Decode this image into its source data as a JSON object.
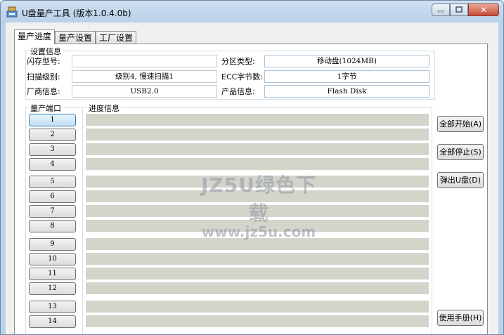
{
  "window": {
    "title": "U盘量产工具 (版本1.0.4.0b)",
    "close_glyph": "✕"
  },
  "tabs": [
    {
      "label": "量产进度"
    },
    {
      "label": "量产设置"
    },
    {
      "label": "工厂设置"
    }
  ],
  "settings": {
    "title": "设置信息",
    "flash_model_label": "闪存型号:",
    "flash_model_value": "",
    "scan_level_label": "扫描级别:",
    "scan_level_value": "级别4, 慢速扫描1",
    "vendor_label": "厂商信息:",
    "vendor_value": "USB2.0",
    "partition_label": "分区类型:",
    "partition_value": "移动盘(1024MB)",
    "ecc_label": "ECC字节数:",
    "ecc_value": "1字节",
    "product_label": "产品信息:",
    "product_value": "Flash Disk"
  },
  "ports": {
    "title": "量产端口",
    "labels": [
      "1",
      "2",
      "3",
      "4",
      "5",
      "6",
      "7",
      "8",
      "9",
      "10",
      "11",
      "12",
      "13",
      "14"
    ]
  },
  "progress": {
    "title": "进度信息"
  },
  "side_buttons": {
    "start_all": "全部开始(A)",
    "stop_all": "全部停止(S)",
    "eject": "弹出U盘(D)",
    "manual": "使用手册(H)"
  },
  "watermark": {
    "line1": "JZ5U绿色下载",
    "line2": "www.jz5u.com"
  }
}
